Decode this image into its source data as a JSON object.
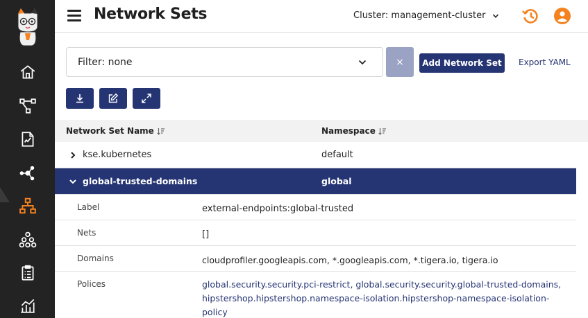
{
  "header": {
    "title": "Network Sets",
    "cluster_label": "Cluster: management-cluster"
  },
  "filter": {
    "value": "Filter: none",
    "clear_label": "×"
  },
  "actions": {
    "add_label": "Add Network Set",
    "export_label": "Export YAML"
  },
  "table": {
    "columns": [
      "Network Set Name",
      "Namespace"
    ],
    "rows": [
      {
        "name": "kse.kubernetes",
        "namespace": "default",
        "expanded": false
      },
      {
        "name": "global-trusted-domains",
        "namespace": "global",
        "expanded": true
      }
    ],
    "details": [
      {
        "key": "Label",
        "value": "external-endpoints:global-trusted"
      },
      {
        "key": "Nets",
        "value": "[]"
      },
      {
        "key": "Domains",
        "value": "cloudprofiler.googleapis.com, *.googleapis.com, *.tigera.io, tigera.io"
      },
      {
        "key": "Polices",
        "value": "global.security.security.pci-restrict, global.security.security.global-trusted-domains, hipstershop.hipstershop.namespace-isolation.hipstershop-namespace-isolation-policy"
      }
    ]
  },
  "colors": {
    "accent": "#253473",
    "sidebar": "#232323",
    "active_icon": "#f5821f"
  },
  "icons": {
    "sidebar": [
      "home-icon",
      "topology-icon",
      "edit-document-icon",
      "nodes-icon",
      "network-sets-icon",
      "hierarchy-icon",
      "clipboard-icon",
      "chart-icon"
    ],
    "tools": [
      "download-icon",
      "edit-icon",
      "expand-icon"
    ]
  }
}
